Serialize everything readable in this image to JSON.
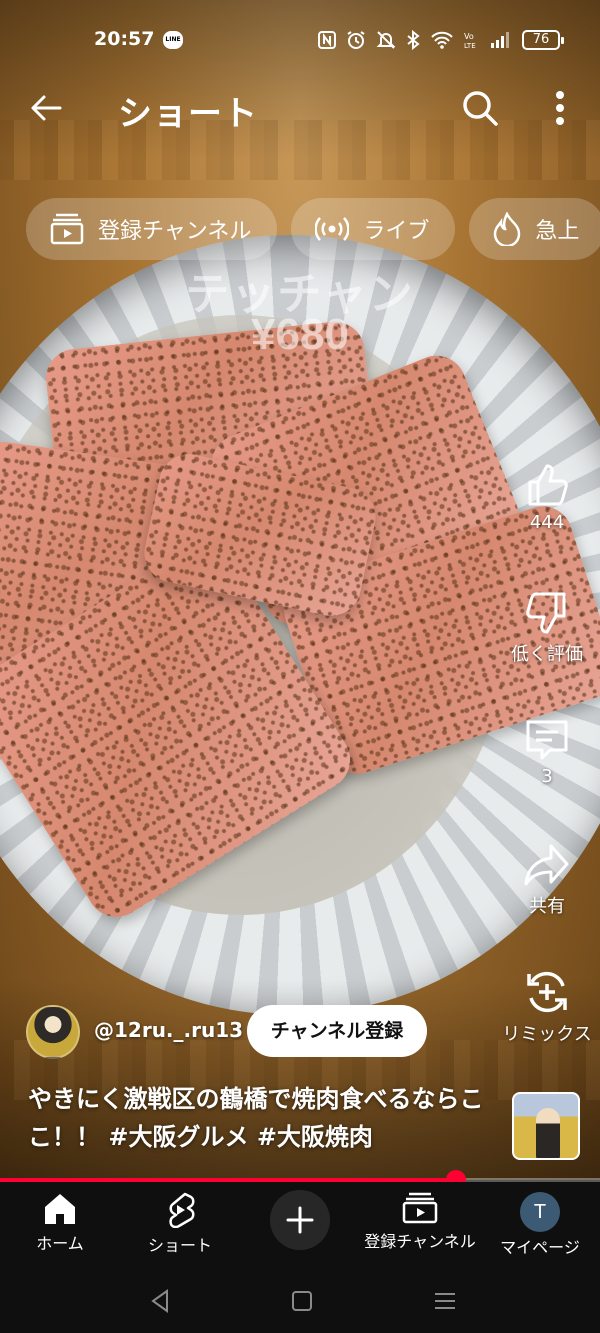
{
  "status_bar": {
    "time": "20:57",
    "line_badge": "LINE",
    "icons": [
      "nfc-icon",
      "alarm-icon",
      "mute-icon",
      "bluetooth-icon",
      "wifi-icon",
      "volte-icon",
      "signal-icon"
    ],
    "battery": "76"
  },
  "app_bar": {
    "title": "ショート"
  },
  "chips": [
    {
      "label": "登録チャンネル",
      "icon": "subscriptions-icon"
    },
    {
      "label": "ライブ",
      "icon": "live-icon"
    },
    {
      "label": "急上",
      "icon": "trending-icon"
    }
  ],
  "video": {
    "caption_name": "テッチャン",
    "caption_price": "¥680",
    "progress_percent": 76
  },
  "rail": {
    "like_count": "444",
    "dislike_label": "低く評価",
    "comment_count": "3",
    "share_label": "共有",
    "remix_label": "リミックス"
  },
  "channel": {
    "handle": "@12ru._.ru13",
    "subscribe_label": "チャンネル登録"
  },
  "description": "やきにく激戦区の鶴橋で焼肉食べるならここ！！ #大阪グルメ #大阪焼肉",
  "bottom_nav": {
    "home": "ホーム",
    "shorts": "ショート",
    "subscriptions": "登録チャンネル",
    "profile": "マイページ",
    "profile_initial": "T"
  },
  "colors": {
    "accent_red": "#ff0033",
    "nav_bg": "#0f0f0f"
  }
}
